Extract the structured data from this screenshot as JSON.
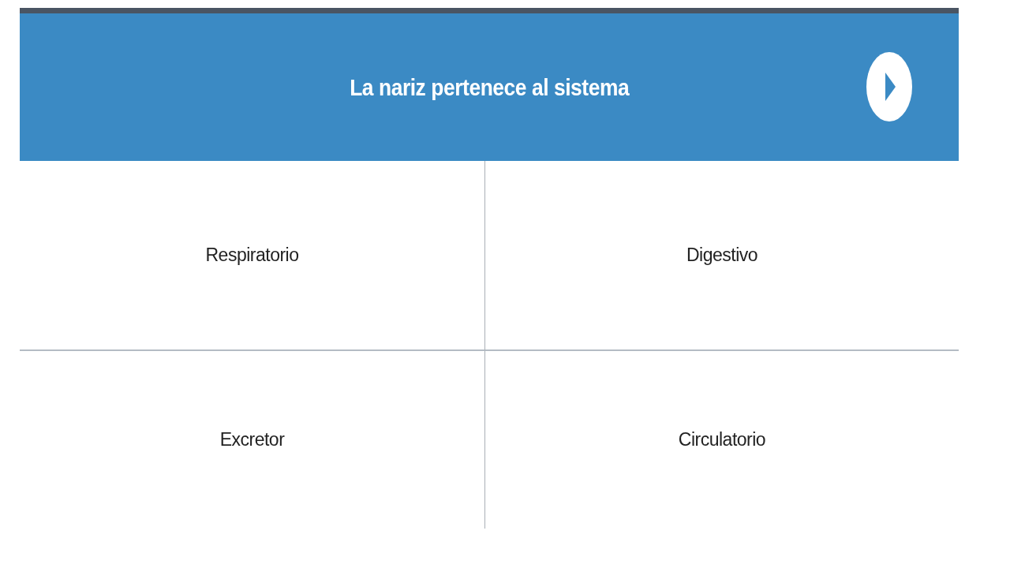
{
  "question": {
    "title": "La nariz pertenece al sistema"
  },
  "options": [
    {
      "label": "Respiratorio"
    },
    {
      "label": "Digestivo"
    },
    {
      "label": "Excretor"
    },
    {
      "label": "Circulatorio"
    }
  ]
}
